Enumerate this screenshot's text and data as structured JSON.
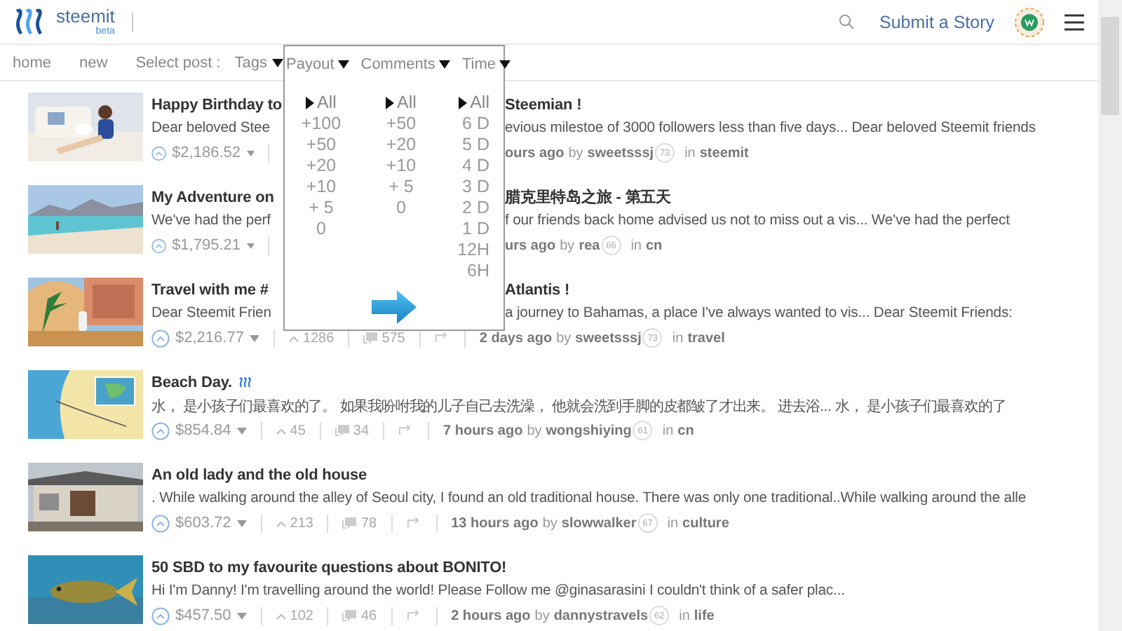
{
  "header": {
    "brand": "steemit",
    "brand_tag": "beta",
    "submit": "Submit a Story"
  },
  "nav": {
    "items": [
      "home",
      "new"
    ],
    "select_label": "Select post :",
    "tags": "Tags"
  },
  "filters": [
    {
      "label": "Payout",
      "options": [
        {
          "label": "All",
          "selected": true
        },
        {
          "label": "+100",
          "selected": false
        },
        {
          "label": "+50",
          "selected": false
        },
        {
          "label": "+20",
          "selected": false
        },
        {
          "label": "+10",
          "selected": false
        },
        {
          "label": "+ 5",
          "selected": false
        },
        {
          "label": "0",
          "selected": false
        }
      ]
    },
    {
      "label": "Comments",
      "options": [
        {
          "label": "All",
          "selected": true
        },
        {
          "label": "+50",
          "selected": false
        },
        {
          "label": "+20",
          "selected": false
        },
        {
          "label": "+10",
          "selected": false
        },
        {
          "label": "+ 5",
          "selected": false
        },
        {
          "label": "0",
          "selected": false
        }
      ]
    },
    {
      "label": "Time",
      "options": [
        {
          "label": "All",
          "selected": true
        },
        {
          "label": "6 D",
          "selected": false
        },
        {
          "label": "5 D",
          "selected": false
        },
        {
          "label": "4 D",
          "selected": false
        },
        {
          "label": "3 D",
          "selected": false
        },
        {
          "label": "2 D",
          "selected": false
        },
        {
          "label": "1 D",
          "selected": false
        },
        {
          "label": "12H",
          "selected": false
        },
        {
          "label": "6H",
          "selected": false
        }
      ]
    }
  ],
  "posts": [
    {
      "title": [
        "Happy Birthday to",
        "Steemian !"
      ],
      "excerpt": [
        "Dear beloved Stee",
        "evious milestoe of 3000 followers less than five days... Dear beloved Steemit friends"
      ],
      "payout": "$2,186.52",
      "time": "ours ago",
      "by": "by",
      "author": "sweetsssj",
      "reputation": "73",
      "in": "in",
      "tag": "steemit",
      "steemit_mark": false
    },
    {
      "title": [
        "My Adventure on",
        "腊克里特岛之旅 - 第五天"
      ],
      "excerpt": [
        "We've had the perf",
        "f our friends back home advised us not to miss out a vis... We've had the perfect"
      ],
      "payout": "$1,795.21",
      "time": "urs ago",
      "by": "by",
      "author": "rea",
      "reputation": "66",
      "in": "in",
      "tag": "cn",
      "steemit_mark": false
    },
    {
      "title": [
        "Travel with me #",
        "Atlantis !"
      ],
      "excerpt": [
        "Dear Steemit Frien",
        "a journey to Bahamas, a place I've always wanted to vis... Dear Steemit Friends:"
      ],
      "payout": "$2,216.77",
      "votes": "1286",
      "comments": "575",
      "time": "2 days ago",
      "by": "by",
      "author": "sweetsssj",
      "reputation": "73",
      "in": "in",
      "tag": "travel",
      "steemit_mark": false
    },
    {
      "title": "Beach Day.",
      "excerpt": "水， 是小孩子们最喜欢的了。 如果我吩咐我的儿子自己去洗澡， 他就会洗到手脚的皮都皱了才出来。 进去浴... 水， 是小孩子们最喜欢的了",
      "payout": "$854.84",
      "votes": "45",
      "comments": "34",
      "time": "7 hours ago",
      "by": "by",
      "author": "wongshiying",
      "reputation": "61",
      "in": "in",
      "tag": "cn",
      "steemit_mark": true
    },
    {
      "title": "An old lady and the old house",
      "excerpt": ". While walking around the alley of Seoul city, I found an old traditional house. There was only one traditional..While walking around the alle",
      "payout": "$603.72",
      "votes": "213",
      "comments": "78",
      "time": "13 hours ago",
      "by": "by",
      "author": "slowwalker",
      "reputation": "67",
      "in": "in",
      "tag": "culture",
      "steemit_mark": false
    },
    {
      "title": "50 SBD to my favourite questions about BONITO!",
      "excerpt": "Hi I'm Danny! I'm travelling around the world! Please Follow me @ginasarasini I couldn't think of a safer plac...",
      "payout": "$457.50",
      "votes": "102",
      "comments": "46",
      "time": "2 hours ago",
      "by": "by",
      "author": "dannystravels",
      "reputation": "62",
      "in": "in",
      "tag": "life",
      "steemit_mark": false
    }
  ]
}
